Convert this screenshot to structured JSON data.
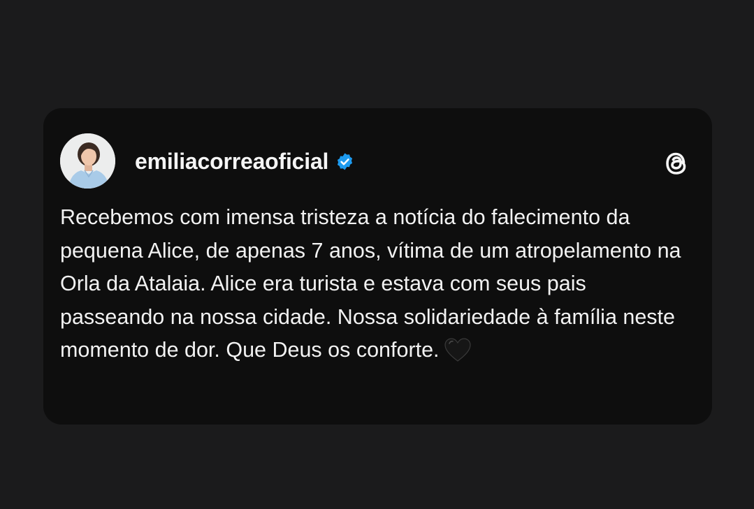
{
  "post": {
    "username": "emiliacorreaoficial",
    "verified": true,
    "verified_icon": "verified-badge-icon",
    "verified_color": "#1d9bf0",
    "platform_icon": "threads-logo-icon",
    "text": "Recebemos com imensa tristeza a notícia do falecimento da pequena Alice, de apenas 7 anos, vítima de um atropelamento na Orla da Atalaia. Alice era turista e estava com seus pais passeando na nossa cidade. Nossa solidariedade à família neste momento de dor. Que Deus os conforte.",
    "trailing_emoji": "black-heart-icon"
  },
  "colors": {
    "page_background": "#1b1b1c",
    "card_background": "#0e0e0e",
    "text": "#f2f2f2"
  }
}
